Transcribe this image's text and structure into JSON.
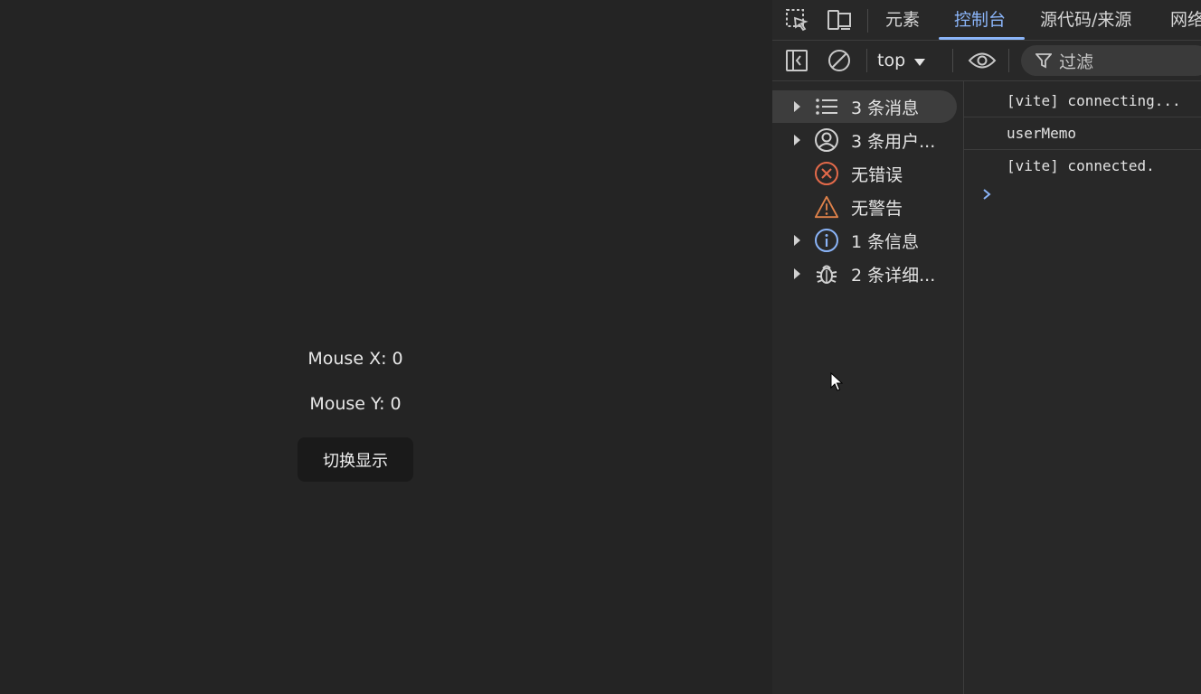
{
  "app": {
    "mouse_x_text": "Mouse X: 0",
    "mouse_y_text": "Mouse Y: 0",
    "toggle_label": "切换显示"
  },
  "devtools": {
    "tabs": [
      {
        "label": "元素",
        "active": false
      },
      {
        "label": "控制台",
        "active": true
      },
      {
        "label": "源代码/来源",
        "active": false
      },
      {
        "label": "网络",
        "active": false
      }
    ],
    "toolbar": {
      "context": "top",
      "filter_placeholder": "过滤"
    },
    "sidebar": [
      {
        "label": "3 条消息",
        "icon": "list-icon",
        "expandable": true,
        "selected": true
      },
      {
        "label": "3 条用户...",
        "icon": "user-icon",
        "expandable": true,
        "selected": false
      },
      {
        "label": "无错误",
        "icon": "error-icon",
        "expandable": false,
        "selected": false
      },
      {
        "label": "无警告",
        "icon": "warning-icon",
        "expandable": false,
        "selected": false
      },
      {
        "label": "1 条信息",
        "icon": "info-icon",
        "expandable": true,
        "selected": false
      },
      {
        "label": "2 条详细...",
        "icon": "bug-icon",
        "expandable": true,
        "selected": false
      }
    ],
    "console_logs": [
      "[vite] connecting...",
      "userMemo",
      "[vite] connected."
    ],
    "colors": {
      "accent": "#8ab4f8",
      "error": "#e46a4a",
      "warning": "#e0824a",
      "info": "#8ab4f8"
    }
  }
}
